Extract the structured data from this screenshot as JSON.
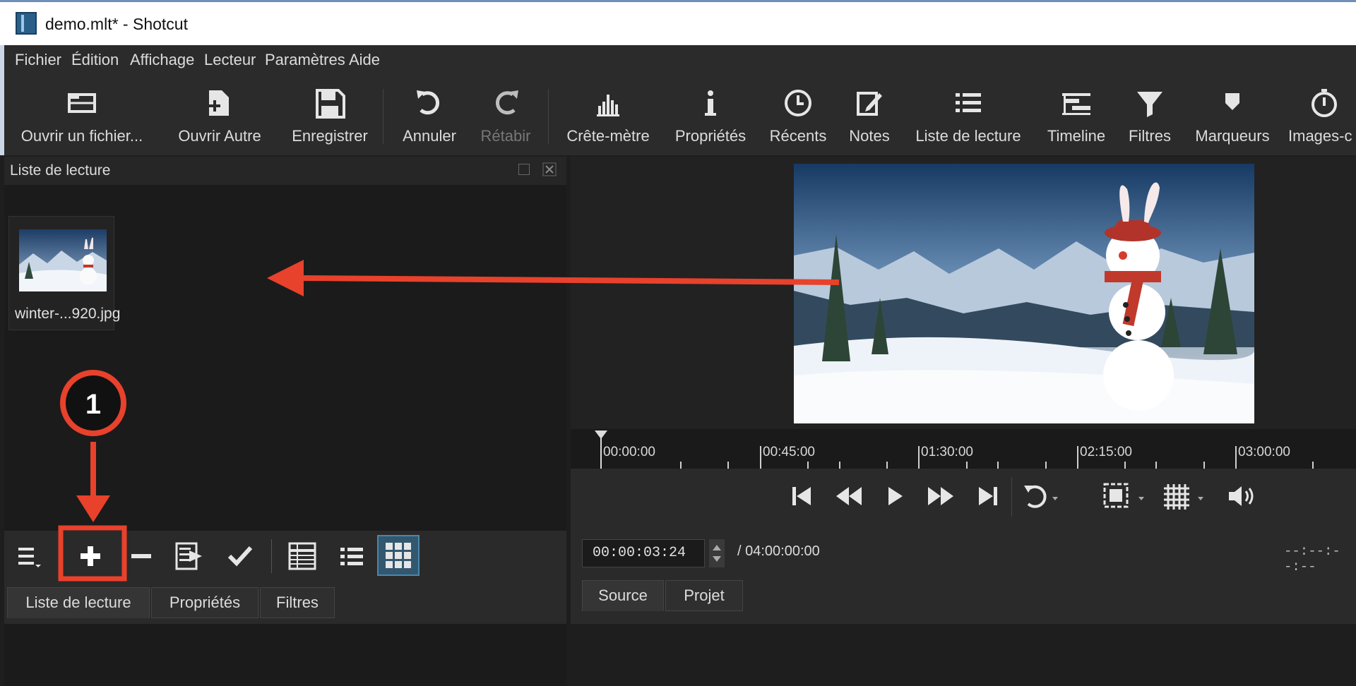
{
  "window": {
    "title": "demo.mlt* - Shotcut"
  },
  "menu": [
    "Fichier",
    "Édition",
    "Affichage",
    "Lecteur",
    "Paramètres",
    "Aide"
  ],
  "toolbar": {
    "open_file": "Ouvrir un fichier...",
    "open_other": "Ouvrir Autre",
    "save": "Enregistrer",
    "undo": "Annuler",
    "redo": "Rétabir",
    "peak_meter": "Crête-mètre",
    "properties": "Propriétés",
    "recent": "Récents",
    "notes": "Notes",
    "playlist": "Liste de lecture",
    "timeline": "Timeline",
    "filters": "Filtres",
    "markers": "Marqueurs",
    "keyframes": "Images-c"
  },
  "playlist_panel": {
    "title": "Liste de lecture",
    "clip_name": "winter-...920.jpg",
    "tabs": [
      "Liste de lecture",
      "Propriétés",
      "Filtres"
    ]
  },
  "player": {
    "ruler_ticks": [
      "00:00:00",
      "00:45:00",
      "01:30:00",
      "02:15:00",
      "03:00:00"
    ],
    "timecode": "00:00:03:24",
    "total_duration": "/ 04:00:00:00",
    "in_point": "--:--:--:--",
    "tabs": [
      "Source",
      "Projet"
    ]
  },
  "annotation": {
    "step_number": "1",
    "arrow_color": "#e8412c"
  }
}
